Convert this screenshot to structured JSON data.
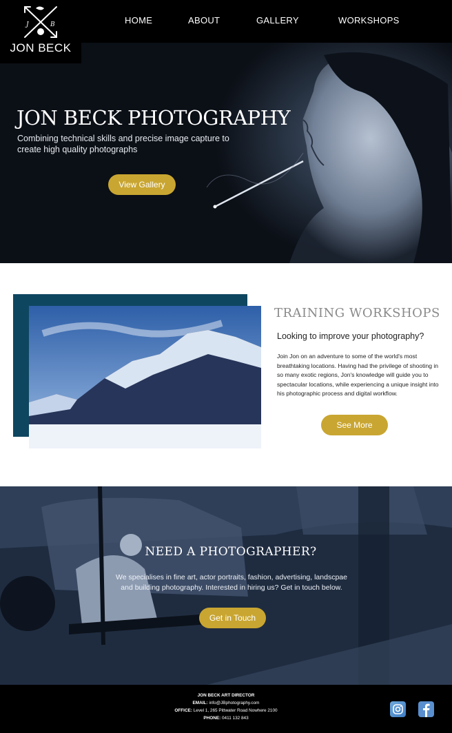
{
  "brand": {
    "name": "JON BECK",
    "monogram_left": "J",
    "monogram_right": "B"
  },
  "nav": {
    "items": [
      {
        "label": "HOME"
      },
      {
        "label": "ABOUT"
      },
      {
        "label": "GALLERY"
      },
      {
        "label": "WORKSHOPS"
      }
    ]
  },
  "hero": {
    "title": "JON BECK PHOTOGRAPHY",
    "subtitle": "Combining technical skills and precise image capture to create high quality photographs",
    "button": "View Gallery"
  },
  "workshops": {
    "title": "TRAINING WORKSHOPS",
    "subtitle": "Looking to improve your photography?",
    "body": "Join Jon on an adventure to some of the world's most breathtaking locations. Having had the privilege of shooting in so many exotic regions, Jon's knowledge will guide you to spectacular locations, while experiencing a unique insight into his photographic process and digital workflow.",
    "button": "See More"
  },
  "hire": {
    "title": "NEED A PHOTOGRAPHER?",
    "body": "We specialises in fine art, actor portraits, fashion, advertising, landscpae and building photography. Interested in hiring us? Get in touch below.",
    "button": "Get in Touch"
  },
  "footer": {
    "title": "JON BECK ART DIRECTOR",
    "email_label": "EMAIL:",
    "email": "info@JBphotography.com",
    "office_label": "OFFICE:",
    "office": "Level 1, 265 Pittwater Road Nowhere 2100",
    "phone_label": "PHONE:",
    "phone": "0411 132 843"
  },
  "social": {
    "icons": [
      "instagram-icon",
      "facebook-icon"
    ]
  },
  "colors": {
    "accent": "#c9a631",
    "block": "#0e4660",
    "heading_gray": "#8a8a8a"
  }
}
